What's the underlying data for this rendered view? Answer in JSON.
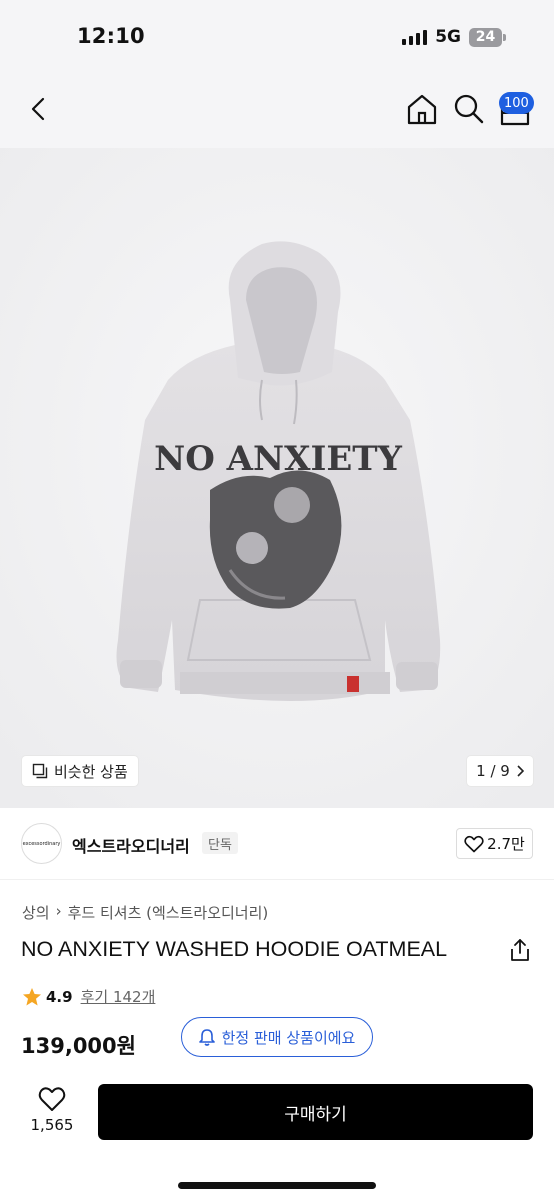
{
  "status_bar": {
    "time": "12:10",
    "network": "5G",
    "battery": "24"
  },
  "nav": {
    "cart_count": "100"
  },
  "image": {
    "print_text": "NO ANXIETY",
    "similar_label": "비슷한 상품",
    "page_indicator": "1 / 9"
  },
  "brand": {
    "logo_text": "excessordinary",
    "name": "엑스트라오디너리",
    "tag": "단독",
    "likes": "2.7만"
  },
  "product": {
    "breadcrumb": [
      "상의",
      "후드 티셔츠 (엑스트라오디너리)"
    ],
    "name": "NO ANXIETY WASHED HOODIE OATMEAL",
    "rating": "4.9",
    "reviews": "후기 142개",
    "price": "139,000원",
    "limited_label": "한정 판매 상품이에요"
  },
  "bottom": {
    "wish_count": "1,565",
    "buy_label": "구매하기"
  },
  "colors": {
    "accent": "#2a5fd8",
    "badge": "#1e5fe0",
    "buy_button": "#000000",
    "star": "#f5a623"
  }
}
